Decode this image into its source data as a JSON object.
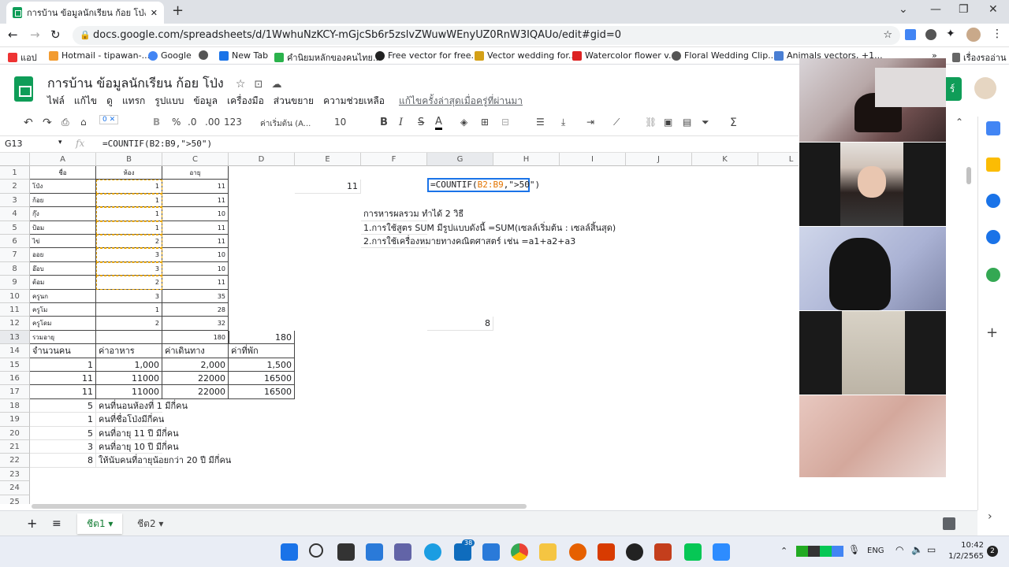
{
  "browser": {
    "tab_title": "การบ้าน ข้อมูลนักเรียน ก้อย โป่ง - Go",
    "url": "docs.google.com/spreadsheets/d/1WwhuNzKCY-mGjcSb6r5zslvZWuwWEnyUZ0RnW3IQAUo/edit#gid=0",
    "bookmarks": [
      "แอป",
      "Hotmail - tipawan-...",
      "Google",
      "New Tab",
      "คำนิยมหลักของคนไทย...",
      "Free vector for free...",
      "Vector wedding for...",
      "Watercolor flower v...",
      "Floral Wedding Clip...",
      "Animals vectors, +1...",
      "»",
      "เรื่องรออ่าน"
    ]
  },
  "sheets": {
    "title": "การบ้าน ข้อมูลนักเรียน ก้อย โป่ง",
    "menu": [
      "ไฟล์",
      "แก้ไข",
      "ดู",
      "แทรก",
      "รูปแบบ",
      "ข้อมูล",
      "เครื่องมือ",
      "ส่วนขยาย",
      "ความช่วยเหลือ"
    ],
    "last_edit": "แก้ไขครั้งล่าสุดเมื่อครู่ที่ผ่านมา",
    "share_label": "ร์",
    "toolbar": {
      "zoom_partial": "0",
      "percent": "%",
      "dec0": ".0",
      "dec00": ".00",
      "fmt": "123",
      "font": "ค่าเริ่มต้น (A...",
      "size": "10",
      "bold": "B",
      "italic": "I",
      "strike": "S",
      "textcolor": "A"
    },
    "namebox": "G13",
    "formula": "=COUNTIF(B2:B9,\">50\")",
    "columns": [
      "A",
      "B",
      "C",
      "D",
      "E",
      "F",
      "G",
      "H",
      "I",
      "J",
      "K",
      "L"
    ],
    "rows": [
      "1",
      "2",
      "3",
      "4",
      "5",
      "6",
      "7",
      "8",
      "9",
      "10",
      "11",
      "12",
      "13",
      "14",
      "15",
      "16",
      "17",
      "18",
      "19",
      "20",
      "21",
      "22",
      "23",
      "24",
      "25"
    ],
    "table_header": {
      "a": "ชื่อ",
      "b": "ห้อง",
      "c": "อายุ"
    },
    "students": [
      {
        "name": "โป๋ง",
        "room": "1",
        "age": "11"
      },
      {
        "name": "ก้อย",
        "room": "1",
        "age": "11"
      },
      {
        "name": "กุ๊ง",
        "room": "1",
        "age": "10"
      },
      {
        "name": "ป้อม",
        "room": "1",
        "age": "11"
      },
      {
        "name": "ไข่",
        "room": "2",
        "age": "11"
      },
      {
        "name": "ออย",
        "room": "3",
        "age": "10"
      },
      {
        "name": "อ๊อบ",
        "room": "3",
        "age": "10"
      },
      {
        "name": "ต้อม",
        "room": "2",
        "age": "11"
      },
      {
        "name": "ครูนก",
        "room": "3",
        "age": "35"
      },
      {
        "name": "ครูโม",
        "room": "1",
        "age": "28"
      },
      {
        "name": "ครูโดม",
        "room": "2",
        "age": "32"
      }
    ],
    "sum_label": "รวมอายุ",
    "sum_c": "180",
    "sum_d": "180",
    "e2": "11",
    "notes": [
      "การหารผลรวม ทำได้ 2 วิธี",
      "1.การใช้สูตร SUM มีรูปแบบดังนี้ =SUM(เซลล์เริ่มต้น : เซลล์สิ้นสุด)",
      "2.การใช้เครื่องหมายทางคณิตศาสตร์ เช่น =a1+a2+a3"
    ],
    "g12": "8",
    "g13_prefix": "=COUNTIF(",
    "g13_range": "B2:B9",
    "g13_suffix": ",\">50\")",
    "row14": [
      "จำนวนคน",
      "ค่าอาหาร",
      "ค่าเดินทาง",
      "ค่าที่พัก"
    ],
    "row15": [
      "1",
      "1,000",
      "2,000",
      "1,500"
    ],
    "row16": [
      "11",
      "11000",
      "22000",
      "16500"
    ],
    "row17": [
      "11",
      "11000",
      "22000",
      "16500"
    ],
    "questions": [
      {
        "n": "5",
        "q": "คนที่นอนห้องที่ 1 มีกี่คน"
      },
      {
        "n": "1",
        "q": "คนที่ชื่อโป่งมีกี่คน"
      },
      {
        "n": "5",
        "q": "คนที่อายุ 11 ปี มีกี่คน"
      },
      {
        "n": "3",
        "q": "คนที่อายุ 10 ปี มีกี่คน"
      },
      {
        "n": "8",
        "q": "ให้นับคนที่อายุน้อยกว่า 20 ปี มีกี่คน"
      }
    ],
    "sheet_tabs": [
      "ชีต1",
      "ชีต2"
    ]
  },
  "taskbar": {
    "lang": "ENG",
    "time": "10:42",
    "date": "1/2/2565",
    "badge": "38",
    "notif": "2"
  }
}
